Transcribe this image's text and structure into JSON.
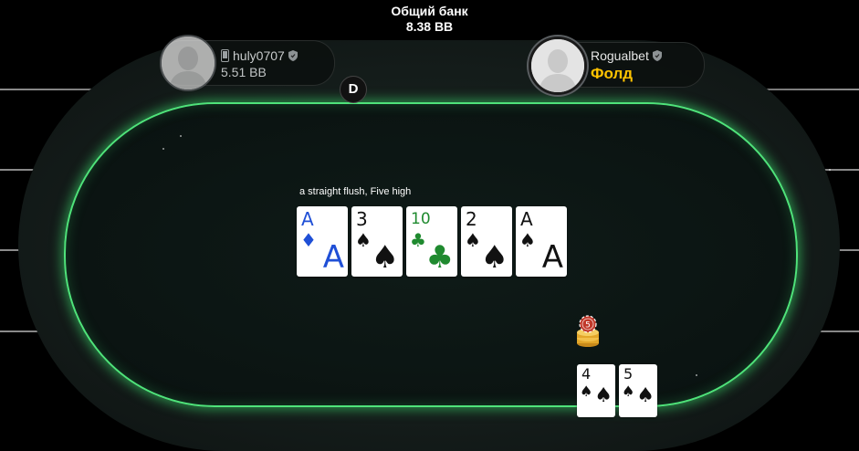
{
  "pot": {
    "label": "Общий банк",
    "amount": "8.38 BB"
  },
  "players": [
    {
      "name": "huly0707",
      "stack": "5.51 BB",
      "device_icon": "mobile-phone-icon",
      "badge_icon": "shield-icon"
    },
    {
      "name": "Rogualbet",
      "status": "Фолд",
      "badge_icon": "shield-icon"
    }
  ],
  "dealer_button": "D",
  "board": {
    "hand_description": "a straight flush, Five high",
    "cards": [
      {
        "rank": "A",
        "suit": "♦",
        "color": "#1f4fd6"
      },
      {
        "rank": "3",
        "suit": "♠",
        "color": "#111111"
      },
      {
        "rank": "10",
        "suit": "♣",
        "color": "#1f8a2f"
      },
      {
        "rank": "2",
        "suit": "♠",
        "color": "#111111"
      },
      {
        "rank": "A",
        "suit": "♠",
        "color": "#111111"
      }
    ]
  },
  "bet_chip": {
    "value": "5"
  },
  "hero_cards": [
    {
      "rank": "4",
      "suit": "♠"
    },
    {
      "rank": "5",
      "suit": "♠"
    }
  ],
  "colors": {
    "felt_border": "#4fe37a",
    "fold_status": "#ffc300",
    "card_blue": "#1f4fd6",
    "card_green": "#1f8a2f"
  }
}
